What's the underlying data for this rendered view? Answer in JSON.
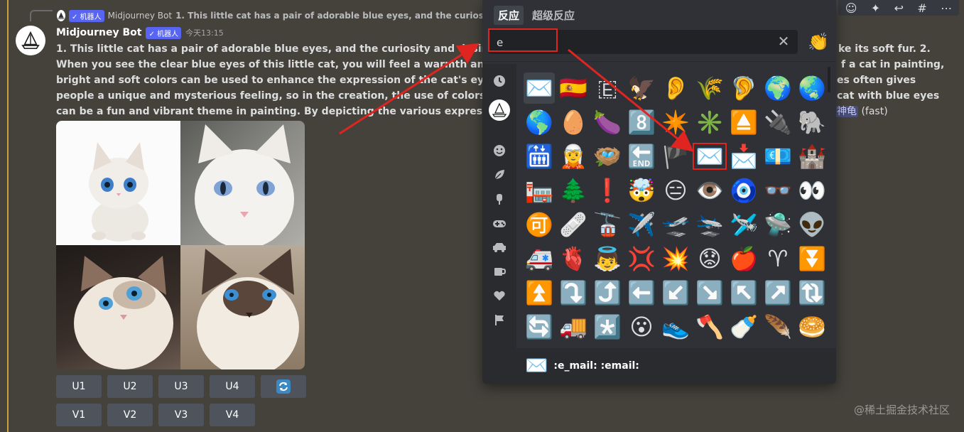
{
  "reply": {
    "bot_tag": "✓ 机器人",
    "name": "Midjourney Bot",
    "text": "1. This little cat has a pair of adorable blue eyes, and the curiosity and"
  },
  "message": {
    "author": "Midjourney Bot",
    "bot_tag": "✓ 机器人",
    "time": "今天13:15",
    "lines": [
      "1. This little cat has a pair of adorable blue eyes, and the curiosity and desire for the w",
      "When you see the clear blue eyes of this little cat, you will feel a warmth and peace, a",
      "bright and soft colors can be used to enhance the expression of the cat's eyes, making",
      "people a unique and mysterious feeling, so in the creation, the use of colors and light",
      "can be a fun and vibrant theme in painting. By depicting the various expressions and p"
    ],
    "right_fragments": [
      "ke its soft fur. 2.",
      "f a cat in painting,",
      "es often gives",
      "cat with blue eyes"
    ],
    "mention": "神龟",
    "speed": "(fast)"
  },
  "buttons": {
    "upscale": [
      "U1",
      "U2",
      "U3",
      "U4"
    ],
    "variation": [
      "V1",
      "V2",
      "V3",
      "V4"
    ],
    "reroll_icon": "refresh-icon"
  },
  "picker": {
    "tabs": [
      "反应",
      "超级反应"
    ],
    "search_value": "e",
    "skin_tone_emoji": "👏",
    "categories": [
      "clock-icon",
      "midjourney-icon",
      "smile-icon",
      "leaf-icon",
      "icecream-icon",
      "gamepad-icon",
      "car-icon",
      "cup-icon",
      "heart-icon",
      "flag-icon"
    ],
    "emojis": [
      [
        "✉️",
        "🇪🇸",
        "🇪",
        "🦅",
        "👂",
        "🌾",
        "🦻",
        "🌍",
        "🌏"
      ],
      [
        "🌎",
        "🥚",
        "🍆",
        "8️⃣",
        "✴️",
        "✳️",
        "⏏️",
        "🔌",
        "🐘"
      ],
      [
        "🛗",
        "🧝",
        "🪺",
        "🔚",
        "🏴",
        "✉️",
        "📩",
        "💶",
        "🏰"
      ],
      [
        "🏣",
        "🌲",
        "❗",
        "🤯",
        "😑",
        "👁️",
        "🧿",
        "👓",
        "👀"
      ],
      [
        "🉑",
        "🩹",
        "🚡",
        "✈️",
        "🛫",
        "🛬",
        "🛩️",
        "🛸",
        "👽"
      ],
      [
        "🚑",
        "🫀",
        "👼",
        "💢",
        "💥",
        "😟",
        "🍎",
        "♈",
        "⏬"
      ],
      [
        "⏫",
        "⤵️",
        "⤴️",
        "⬅️",
        "↙️",
        "↘️",
        "↖️",
        "↗️",
        "🔃"
      ],
      [
        "🔄",
        "🚚",
        "*️⃣",
        "😮",
        "👟",
        "🪓",
        "🍼",
        "🪶",
        "🥯"
      ]
    ],
    "footer_emoji": "✉️",
    "footer_text": ":e_mail: :email:"
  },
  "toolbar": {
    "icons": [
      "add-reaction-icon",
      "super-reaction-icon",
      "reply-icon",
      "thread-icon",
      "more-icon"
    ]
  },
  "watermark": "@稀土掘金技术社区"
}
